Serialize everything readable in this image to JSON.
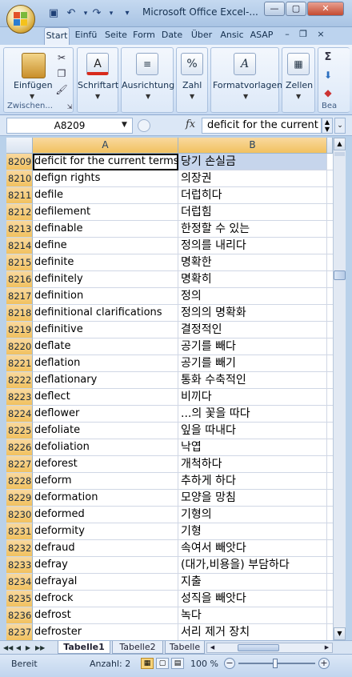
{
  "window": {
    "title": "Microsoft Office Excel-...",
    "minimize_glyph": "—",
    "maximize_glyph": "▢",
    "close_glyph": "✕"
  },
  "quick_access": {
    "save_glyph": "💾",
    "undo_glyph": "↶",
    "redo_glyph": "↷",
    "customize_glyph": "▾"
  },
  "tabs": [
    "Start",
    "Einfü",
    "Seite",
    "Form",
    "Date",
    "Über",
    "Ansic",
    "ASAP"
  ],
  "tab_controls": {
    "minimize": "–",
    "restore": "❐",
    "close": "×"
  },
  "ribbon": {
    "paste_label": "Einfügen",
    "clipboard_group": "Zwischen...",
    "font_label": "Schriftart",
    "alignment_label": "Ausrichtung",
    "number_label": "Zahl",
    "styles_label": "Formatvorlagen",
    "cells_label": "Zellen",
    "editing_label": "Bea",
    "font_icon": "A",
    "number_icon": "%",
    "styles_icon": "A",
    "sum_icon": "Σ"
  },
  "formula_bar": {
    "name_box": "A8209",
    "fx_label": "fx",
    "content": "deficit for the current"
  },
  "columns": [
    "A",
    "B"
  ],
  "rows": [
    {
      "num": "8209",
      "en": "deficit for the current terms",
      "ko": "당기 손실금"
    },
    {
      "num": "8210",
      "en": "defign rights",
      "ko": "의장권"
    },
    {
      "num": "8211",
      "en": "defile",
      "ko": "더럽히다"
    },
    {
      "num": "8212",
      "en": "defilement",
      "ko": "더럽힘"
    },
    {
      "num": "8213",
      "en": "definable",
      "ko": "한정할 수 있는"
    },
    {
      "num": "8214",
      "en": "define",
      "ko": "정의를 내리다"
    },
    {
      "num": "8215",
      "en": "definite",
      "ko": "명확한"
    },
    {
      "num": "8216",
      "en": "definitely",
      "ko": "명확히"
    },
    {
      "num": "8217",
      "en": "definition",
      "ko": "정의"
    },
    {
      "num": "8218",
      "en": "definitional clarifications",
      "ko": "정의의 명확화"
    },
    {
      "num": "8219",
      "en": "definitive",
      "ko": "결정적인"
    },
    {
      "num": "8220",
      "en": "deflate",
      "ko": "공기를 빼다"
    },
    {
      "num": "8221",
      "en": "deflation",
      "ko": "공기를 빼기"
    },
    {
      "num": "8222",
      "en": "deflationary",
      "ko": "통화 수축적인"
    },
    {
      "num": "8223",
      "en": "deflect",
      "ko": "비끼다"
    },
    {
      "num": "8224",
      "en": "deflower",
      "ko": "...의 꽃을 따다"
    },
    {
      "num": "8225",
      "en": "defoliate",
      "ko": "잎을 따내다"
    },
    {
      "num": "8226",
      "en": "defoliation",
      "ko": "낙엽"
    },
    {
      "num": "8227",
      "en": "deforest",
      "ko": "개척하다"
    },
    {
      "num": "8228",
      "en": "deform",
      "ko": "추하게 하다"
    },
    {
      "num": "8229",
      "en": "deformation",
      "ko": "모양을 망침"
    },
    {
      "num": "8230",
      "en": "deformed",
      "ko": "기형의"
    },
    {
      "num": "8231",
      "en": "deformity",
      "ko": "기형"
    },
    {
      "num": "8232",
      "en": "defraud",
      "ko": "속여서 빼앗다"
    },
    {
      "num": "8233",
      "en": "defray",
      "ko": "(대가,비용을) 부담하다"
    },
    {
      "num": "8234",
      "en": "defrayal",
      "ko": "지출"
    },
    {
      "num": "8235",
      "en": "defrock",
      "ko": "성직을 빼앗다"
    },
    {
      "num": "8236",
      "en": "defrost",
      "ko": "녹다"
    },
    {
      "num": "8237",
      "en": "defroster",
      "ko": "서리 제거 장치"
    }
  ],
  "sheets": [
    "Tabelle1",
    "Tabelle2",
    "Tabelle"
  ],
  "sheet_nav": [
    "◀◀",
    "◀",
    "▶",
    "▶▶"
  ],
  "status": {
    "ready": "Bereit",
    "count": "Anzahl: 2",
    "zoom": "100 %",
    "zoom_out": "−",
    "zoom_in": "+"
  },
  "colors": {
    "accent": "#f1c15f",
    "ribbon": "#d6e4f6",
    "selection": "#c6d5ec"
  }
}
